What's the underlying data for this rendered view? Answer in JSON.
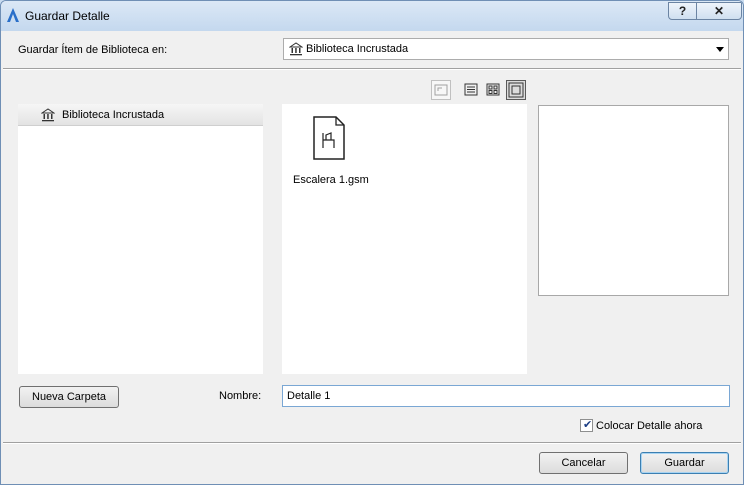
{
  "window": {
    "title": "Guardar Detalle",
    "help_label": "?",
    "close_label": "✕"
  },
  "location": {
    "label": "Guardar Ítem de Biblioteca en:",
    "selected": "Biblioteca Incrustada"
  },
  "tree": {
    "items": [
      {
        "label": "Biblioteca Incrustada"
      }
    ]
  },
  "files": [
    {
      "name": "Escalera 1.gsm"
    }
  ],
  "new_folder_label": "Nueva Carpeta",
  "name": {
    "label": "Nombre:",
    "value": "Detalle 1"
  },
  "place_now": {
    "label": "Colocar Detalle ahora",
    "checked": true
  },
  "buttons": {
    "cancel": "Cancelar",
    "save": "Guardar"
  }
}
